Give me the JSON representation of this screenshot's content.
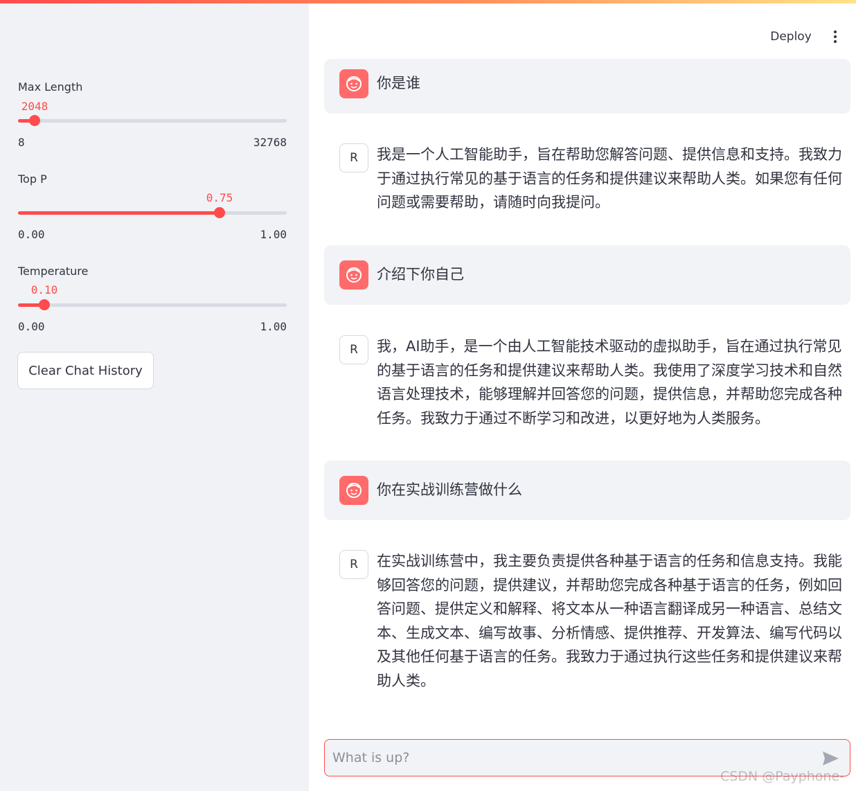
{
  "sidebar": {
    "sliders": {
      "max_length": {
        "label": "Max Length",
        "value": "2048",
        "min": "8",
        "max": "32768",
        "fraction": 0.06
      },
      "top_p": {
        "label": "Top P",
        "value": "0.75",
        "min": "0.00",
        "max": "1.00",
        "fraction": 0.75
      },
      "temperature": {
        "label": "Temperature",
        "value": "0.10",
        "min": "0.00",
        "max": "1.00",
        "fraction": 0.1
      }
    },
    "clear_button": "Clear Chat History"
  },
  "header": {
    "deploy": "Deploy"
  },
  "messages": [
    {
      "role": "user",
      "text": "你是谁"
    },
    {
      "role": "assistant",
      "avatar": "R",
      "text": "我是一个人工智能助手，旨在帮助您解答问题、提供信息和支持。我致力于通过执行常见的基于语言的任务和提供建议来帮助人类。如果您有任何问题或需要帮助，请随时向我提问。"
    },
    {
      "role": "user",
      "text": "介绍下你自己"
    },
    {
      "role": "assistant",
      "avatar": "R",
      "text": "我，AI助手，是一个由人工智能技术驱动的虚拟助手，旨在通过执行常见的基于语言的任务和提供建议来帮助人类。我使用了深度学习技术和自然语言处理技术，能够理解并回答您的问题，提供信息，并帮助您完成各种任务。我致力于通过不断学习和改进，以更好地为人类服务。"
    },
    {
      "role": "user",
      "text": "你在实战训练营做什么"
    },
    {
      "role": "assistant",
      "avatar": "R",
      "text": "在实战训练营中，我主要负责提供各种基于语言的任务和信息支持。我能够回答您的问题，提供建议，并帮助您完成各种基于语言的任务，例如回答问题、提供定义和解释、将文本从一种语言翻译成另一种语言、总结文本、生成文本、编写故事、分析情感、提供推荐、开发算法、编写代码以及其他任何基于语言的任务。我致力于通过执行这些任务和提供建议来帮助人类。"
    }
  ],
  "chat_input": {
    "placeholder": "What is up?"
  },
  "watermark": "CSDN @Payphone-",
  "colors": {
    "accent": "#ff4b4b",
    "sidebar_bg": "#f0f2f6",
    "user_msg_bg": "#f1f3f6",
    "user_avatar": "#ff6b6b"
  },
  "icons": {
    "menu": "kebab-menu-icon",
    "send": "send-icon",
    "user_avatar": "face-avatar-icon"
  }
}
